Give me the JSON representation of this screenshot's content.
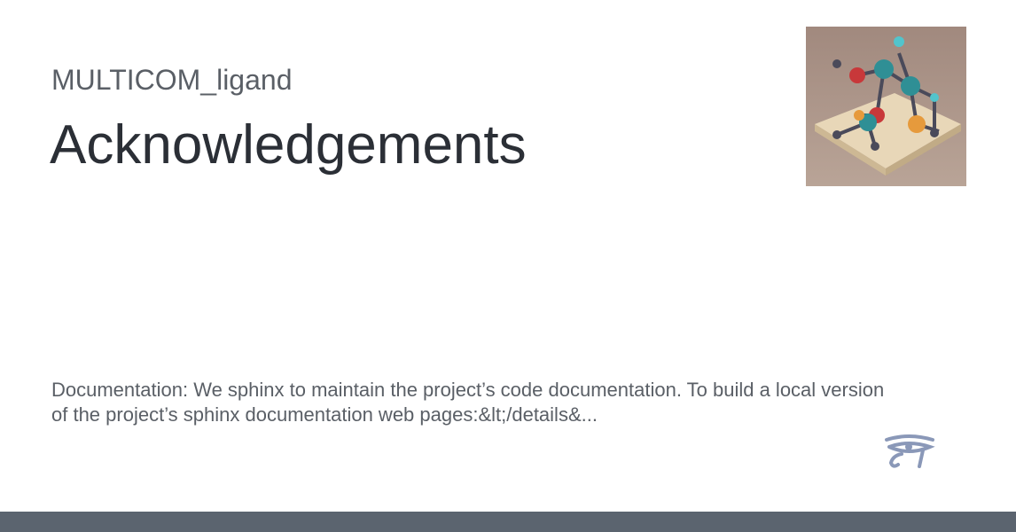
{
  "site_name": "MULTICOM_ligand",
  "page_title": "Acknowledgements",
  "description": "Documentation: We sphinx to maintain the project’s code documentation. To build a local version of the project’s sphinx documentation web pages:&lt;/details&...",
  "colors": {
    "bottom_bar": "#5b646f",
    "logo": "#8a98b8"
  },
  "icons": {
    "logo": "eye-of-horus-icon",
    "image": "molecule-illustration"
  }
}
